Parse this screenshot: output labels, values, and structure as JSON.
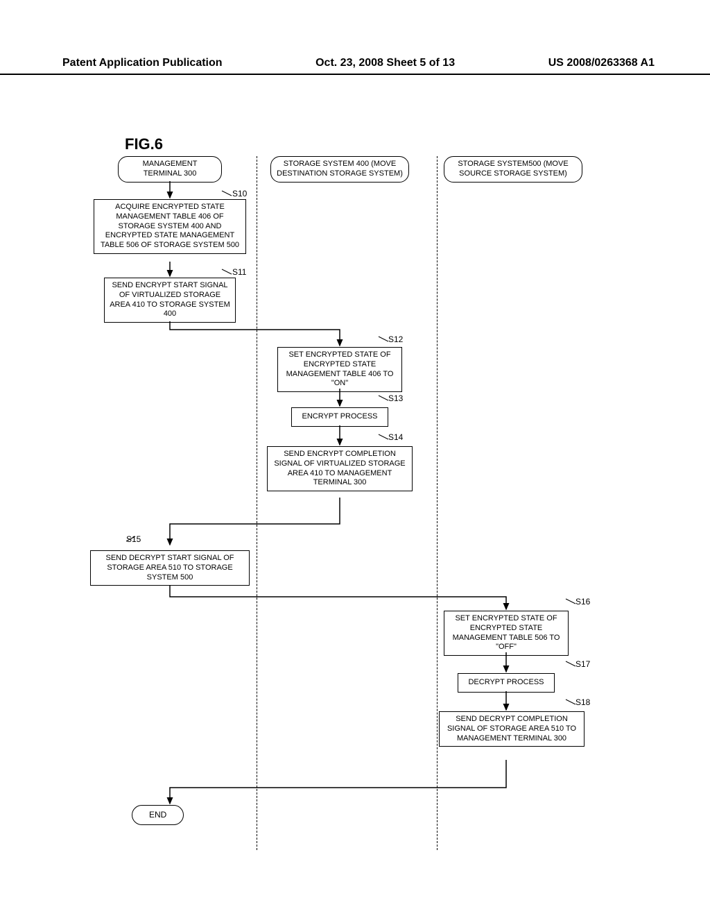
{
  "header": {
    "left": "Patent Application Publication",
    "center": "Oct. 23, 2008  Sheet 5 of 13",
    "right": "US 2008/0263368 A1"
  },
  "figure_label": "FIG.6",
  "lanes": {
    "col1": "MANAGEMENT TERMINAL 300",
    "col2": "STORAGE SYSTEM 400 (MOVE DESTINATION STORAGE SYSTEM)",
    "col3": "STORAGE SYSTEM500 (MOVE SOURCE STORAGE SYSTEM)"
  },
  "steps": {
    "s10": {
      "label": "S10",
      "text": "ACQUIRE ENCRYPTED STATE MANAGEMENT TABLE 406 OF STORAGE SYSTEM 400 AND ENCRYPTED STATE MANAGEMENT TABLE 506 OF STORAGE SYSTEM 500"
    },
    "s11": {
      "label": "S11",
      "text": "SEND ENCRYPT START SIGNAL OF VIRTUALIZED STORAGE AREA 410 TO STORAGE SYSTEM 400"
    },
    "s12": {
      "label": "S12",
      "text": "SET ENCRYPTED STATE OF ENCRYPTED STATE MANAGEMENT TABLE 406 TO \"ON\""
    },
    "s13": {
      "label": "S13",
      "text": "ENCRYPT PROCESS"
    },
    "s14": {
      "label": "S14",
      "text": "SEND ENCRYPT COMPLETION SIGNAL OF VIRTUALIZED STORAGE AREA 410 TO MANAGEMENT TERMINAL 300"
    },
    "s15": {
      "label": "S15",
      "text": "SEND DECRYPT START SIGNAL OF STORAGE AREA 510 TO STORAGE SYSTEM 500"
    },
    "s16": {
      "label": "S16",
      "text": "SET ENCRYPTED STATE OF ENCRYPTED STATE MANAGEMENT TABLE 506 TO \"OFF\""
    },
    "s17": {
      "label": "S17",
      "text": "DECRYPT PROCESS"
    },
    "s18": {
      "label": "S18",
      "text": "SEND DECRYPT COMPLETION SIGNAL OF STORAGE AREA 510 TO MANAGEMENT TERMINAL 300"
    }
  },
  "end": "END"
}
